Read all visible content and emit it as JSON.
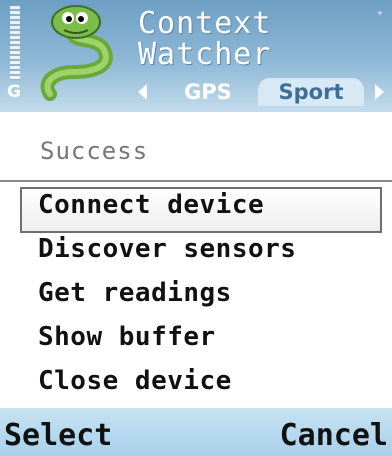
{
  "app": {
    "title_line1": "Context",
    "title_line2": "Watcher"
  },
  "status": {
    "network": "G",
    "indicator": "⁺"
  },
  "tabs": [
    {
      "label": "GPS"
    },
    {
      "label": "Sport"
    }
  ],
  "info_text": "Success",
  "menu": {
    "items": [
      {
        "label": "Connect device"
      },
      {
        "label": "Discover sensors"
      },
      {
        "label": "Get readings"
      },
      {
        "label": "Show buffer"
      },
      {
        "label": "Close device"
      }
    ]
  },
  "softkeys": {
    "left": "Select",
    "right": "Cancel"
  },
  "colors": {
    "status_bg": "#8fb8d6",
    "softkey_bg": "#b8dbef",
    "tab_active_bg": "#d7e9f4"
  },
  "icons": {
    "app_icon": "snake-mascot-icon",
    "signal_icon": "signal-strength-icon"
  }
}
